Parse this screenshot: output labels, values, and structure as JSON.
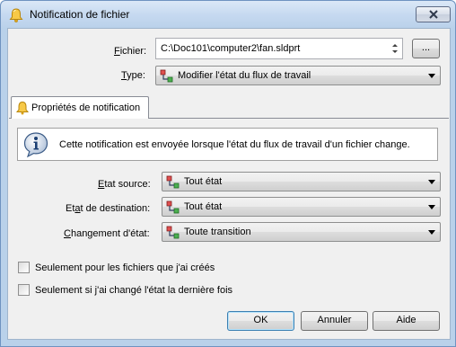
{
  "window": {
    "title": "Notification de fichier",
    "close_icon": "close-icon"
  },
  "form": {
    "file_label_pre": "",
    "file_label_ul": "F",
    "file_label_post": "ichier:",
    "file_value": "C:\\Doc101\\computer2\\fan.sldprt",
    "browse_label": "...",
    "type_label_pre": "",
    "type_label_ul": "T",
    "type_label_post": "ype:",
    "type_value": "Modifier l'état du flux de travail"
  },
  "tab": {
    "label": "Propriétés de notification"
  },
  "info": {
    "text": "Cette notification est envoyée lorsque l'état du flux de travail d'un fichier change."
  },
  "fields": {
    "source_label_pre": "",
    "source_label_ul": "E",
    "source_label_post": "tat source:",
    "source_value": "Tout état",
    "dest_label_pre": "Et",
    "dest_label_ul": "a",
    "dest_label_post": "t de destination:",
    "dest_value": "Tout état",
    "change_label_pre": "",
    "change_label_ul": "C",
    "change_label_post": "hangement d'état:",
    "change_value": "Toute transition"
  },
  "checks": {
    "own_files": "Seulement pour les fichiers que j'ai créés",
    "own_files_checked": false,
    "last_changed": "Seulement si j'ai changé l'état la dernière fois",
    "last_changed_checked": false
  },
  "buttons": {
    "ok": "OK",
    "cancel": "Annuler",
    "help": "Aide"
  }
}
